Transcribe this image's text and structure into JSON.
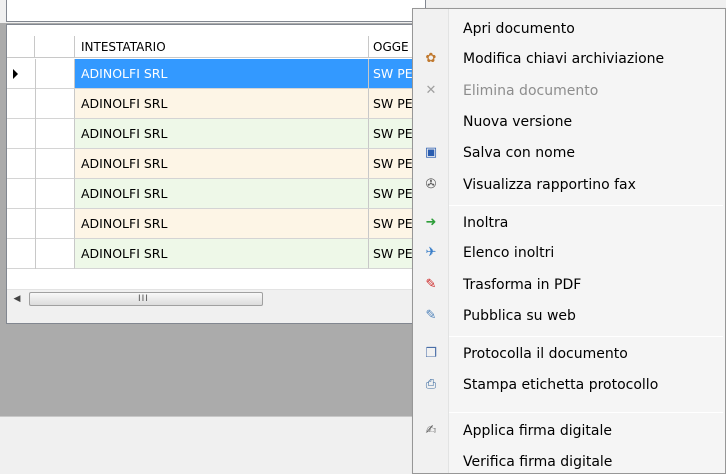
{
  "grid": {
    "columns": [
      "INTESTATARIO",
      "OGGE"
    ],
    "rows": [
      {
        "intestatario": "ADINOLFI SRL",
        "oggetto": "SW PE",
        "bg": "#3399ff"
      },
      {
        "intestatario": "ADINOLFI SRL",
        "oggetto": "SW PE",
        "bg": "#fdf5e6"
      },
      {
        "intestatario": "ADINOLFI SRL",
        "oggetto": "SW PE",
        "bg": "#eef8e8"
      },
      {
        "intestatario": "ADINOLFI SRL",
        "oggetto": "SW PE",
        "bg": "#fdf5e6"
      },
      {
        "intestatario": "ADINOLFI SRL",
        "oggetto": "SW PE",
        "bg": "#eef8e8"
      },
      {
        "intestatario": "ADINOLFI SRL",
        "oggetto": "SW PE",
        "bg": "#fdf5e6"
      },
      {
        "intestatario": "ADINOLFI SRL",
        "oggetto": "SW PE",
        "bg": "#eef8e8"
      }
    ],
    "scroll_left_glyph": "◀",
    "scroll_grip": "III"
  },
  "menu": {
    "items": [
      {
        "label": "Apri documento",
        "icon": "",
        "icon_name": "none"
      },
      {
        "label": "Modifica chiavi archiviazione",
        "icon": "✿",
        "icon_name": "palette-icon",
        "color": "#c0792f"
      },
      {
        "label": "Elimina documento",
        "icon": "✕",
        "icon_name": "delete-icon",
        "color": "#a0a0a0",
        "disabled": true
      },
      {
        "label": "Nuova versione",
        "icon": "",
        "icon_name": "none"
      },
      {
        "label": "Salva con nome",
        "icon": "▣",
        "icon_name": "floppy-disk-icon",
        "color": "#2a5db0"
      },
      {
        "label": "Visualizza rapportino fax",
        "icon": "✇",
        "icon_name": "fax-icon",
        "color": "#555555"
      },
      {
        "label": "Inoltra",
        "icon": "➜",
        "icon_name": "forward-icon",
        "color": "#2e9e3a"
      },
      {
        "label": "Elenco inoltri",
        "icon": "✈",
        "icon_name": "forward-list-icon",
        "color": "#3a7fc9"
      },
      {
        "label": "Trasforma in PDF",
        "icon": "✎",
        "icon_name": "pdf-icon",
        "color": "#cc2020"
      },
      {
        "label": "Pubblica su web",
        "icon": "✎",
        "icon_name": "web-publish-icon",
        "color": "#4a7fb8"
      },
      {
        "label": "Protocolla il documento",
        "icon": "❐",
        "icon_name": "protocol-icon",
        "color": "#4a6fa8"
      },
      {
        "label": "Stampa etichetta protocollo",
        "icon": "⎙",
        "icon_name": "label-printer-icon",
        "color": "#3a6aa0"
      },
      {
        "label": "Applica firma digitale",
        "icon": "✍",
        "icon_name": "digital-signature-icon",
        "color": "#666666"
      },
      {
        "label": "Verifica firma digitale",
        "icon": "",
        "icon_name": "none"
      }
    ]
  }
}
